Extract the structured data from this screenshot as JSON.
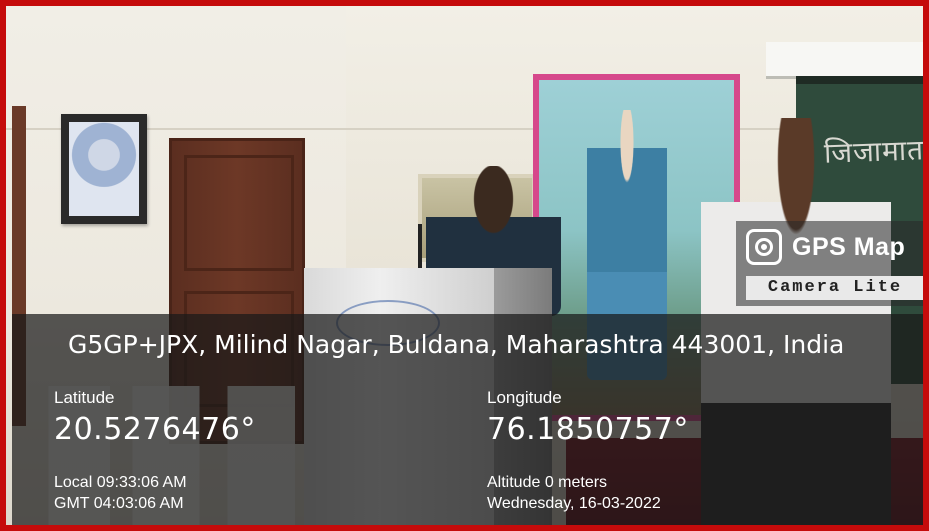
{
  "overlay": {
    "logo": {
      "title": "GPS Map",
      "subtitle": "Camera Lite",
      "icon": "camera-lens-icon"
    },
    "address": "G5GP+JPX, Milind Nagar, Buldana, Maharashtra 443001, India",
    "latitude": {
      "label": "Latitude",
      "value": "20.5276476°"
    },
    "longitude": {
      "label": "Longitude",
      "value": "76.1850757°"
    },
    "local_time": "Local 09:33:06 AM",
    "gmt_time": "GMT 04:03:06 AM",
    "altitude": "Altitude 0 meters",
    "date": "Wednesday, 16-03-2022"
  },
  "scene": {
    "board_text": "जिजामात",
    "colors": {
      "frame_border": "#c50b0b",
      "painting_border": "#d6488b",
      "overlay_bg": "#191919"
    }
  }
}
